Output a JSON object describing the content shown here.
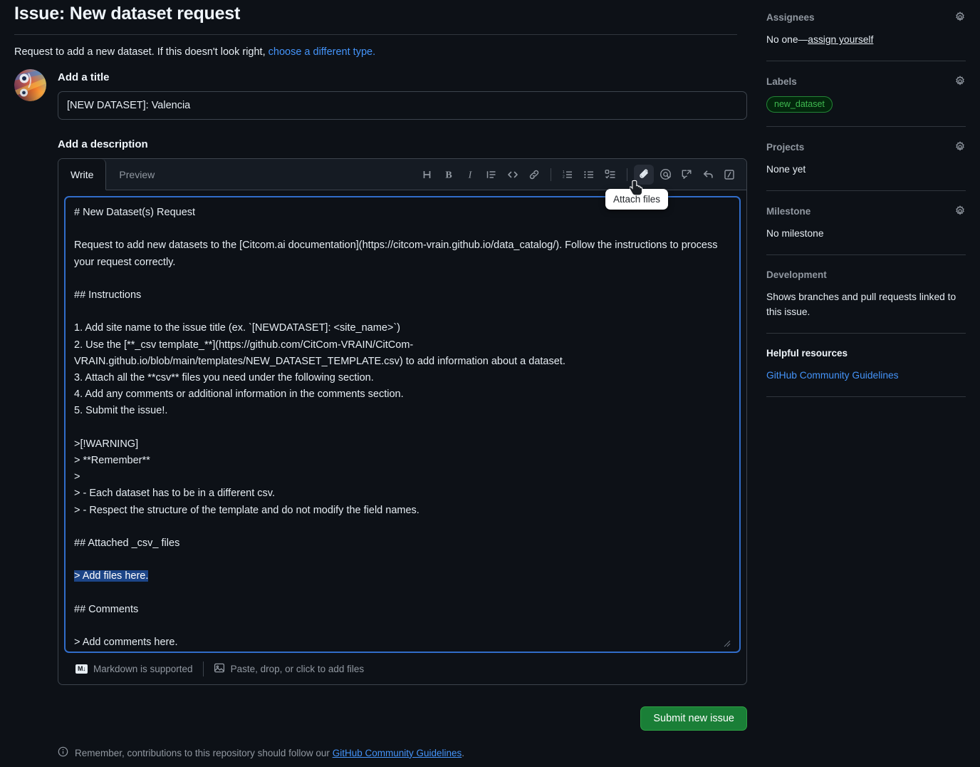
{
  "header": {
    "title": "Issue: New dataset request",
    "subline_text": "Request to add a new dataset. If this doesn't look right, ",
    "subline_link": "choose a different type."
  },
  "form": {
    "title_label": "Add a title",
    "title_value": "[NEW DATASET]: Valencia",
    "title_placeholder": "Title",
    "description_label": "Add a description"
  },
  "editor": {
    "tabs": [
      {
        "label": "Write",
        "active": true
      },
      {
        "label": "Preview",
        "active": false
      }
    ],
    "toolbar": [
      {
        "name": "heading-icon",
        "title": "Heading"
      },
      {
        "name": "bold-icon",
        "title": "Bold"
      },
      {
        "name": "italic-icon",
        "title": "Italic"
      },
      {
        "name": "quote-icon",
        "title": "Quote"
      },
      {
        "name": "code-icon",
        "title": "Code"
      },
      {
        "name": "link-icon",
        "title": "Link"
      },
      {
        "name": "ordered-list-icon",
        "title": "Numbered list"
      },
      {
        "name": "unordered-list-icon",
        "title": "Bulleted list"
      },
      {
        "name": "task-list-icon",
        "title": "Task list"
      },
      {
        "name": "attach-files-icon",
        "title": "Attach files"
      },
      {
        "name": "mention-icon",
        "title": "Mention"
      },
      {
        "name": "cross-reference-icon",
        "title": "Reference"
      },
      {
        "name": "reply-icon",
        "title": "Reply"
      },
      {
        "name": "slash-command-icon",
        "title": "Slash commands"
      }
    ],
    "tooltip": "Attach files",
    "body_part1": "# New Dataset(s) Request\n\nRequest to add new datasets to the [Citcom.ai documentation](https://citcom-vrain.github.io/data_catalog/). Follow the instructions to process your request correctly.\n\n## Instructions\n\n1. Add site name to the issue title (ex. `[NEWDATASET]: <site_name>`)\n2. Use the [**_csv template_**](https://github.com/CitCom-VRAIN/CitCom-VRAIN.github.io/blob/main/templates/NEW_DATASET_TEMPLATE.csv) to add information about a dataset.\n3. Attach all the **csv** files you need under the following section.\n4. Add any comments or additional information in the comments section.\n5. Submit the issue!.\n\n>[!WARNING]\n> **Remember**\n>\n> - Each dataset has to be in a different csv.\n> - Respect the structure of the template and do not modify the field names.\n\n## Attached _csv_ files\n\n",
    "body_selected": "> Add files here.",
    "body_part2": "\n\n## Comments\n\n> Add comments here.",
    "footer_markdown": "Markdown is supported",
    "footer_paste": "Paste, drop, or click to add files",
    "markdown_badge": "M"
  },
  "actions": {
    "submit_label": "Submit new issue"
  },
  "page_footer": {
    "text": "Remember, contributions to this repository should follow our ",
    "link": "GitHub Community Guidelines",
    "suffix": "."
  },
  "sidebar": {
    "sections": [
      {
        "title": "Assignees",
        "has_gear": true,
        "body_text": "No one—",
        "body_link": "assign yourself",
        "type": "assignees"
      },
      {
        "title": "Labels",
        "has_gear": true,
        "label": "new_dataset",
        "type": "labels"
      },
      {
        "title": "Projects",
        "has_gear": true,
        "body_text": "None yet",
        "type": "text"
      },
      {
        "title": "Milestone",
        "has_gear": true,
        "body_text": "No milestone",
        "type": "text"
      },
      {
        "title": "Development",
        "has_gear": false,
        "body_text": "Shows branches and pull requests linked to this issue.",
        "type": "text"
      },
      {
        "title": "Helpful resources",
        "has_gear": false,
        "body_link": "GitHub Community Guidelines",
        "type": "resources"
      }
    ]
  },
  "colors": {
    "background": "#0d1117",
    "accent_link": "#4493f8",
    "focus_border": "#316dca",
    "submit_green": "#1a7f37",
    "label_green": "#3fb950",
    "selection_blue": "#1c4587"
  }
}
